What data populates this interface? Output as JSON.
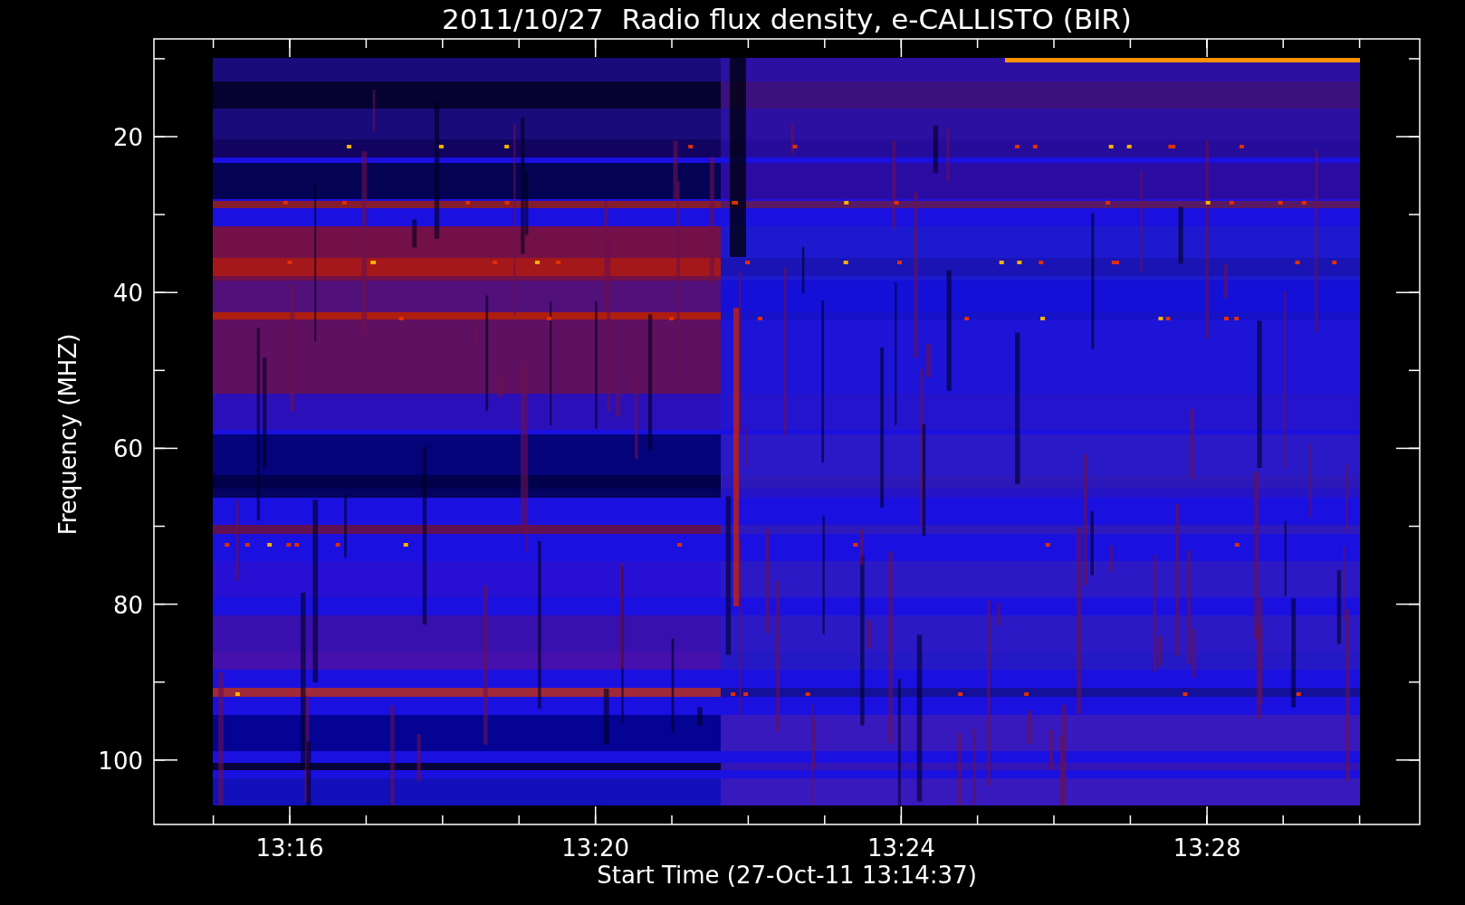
{
  "title": "2011/10/27  Radio flux density, e-CALLISTO (BIR)",
  "x_axis": {
    "label": "Start Time (27-Oct-11 13:14:37)",
    "tick_labels": [
      "13:16",
      "13:20",
      "13:24",
      "13:28"
    ]
  },
  "y_axis": {
    "label": "Frequency (MHZ)",
    "tick_labels": [
      "20",
      "40",
      "60",
      "80",
      "100"
    ]
  }
}
